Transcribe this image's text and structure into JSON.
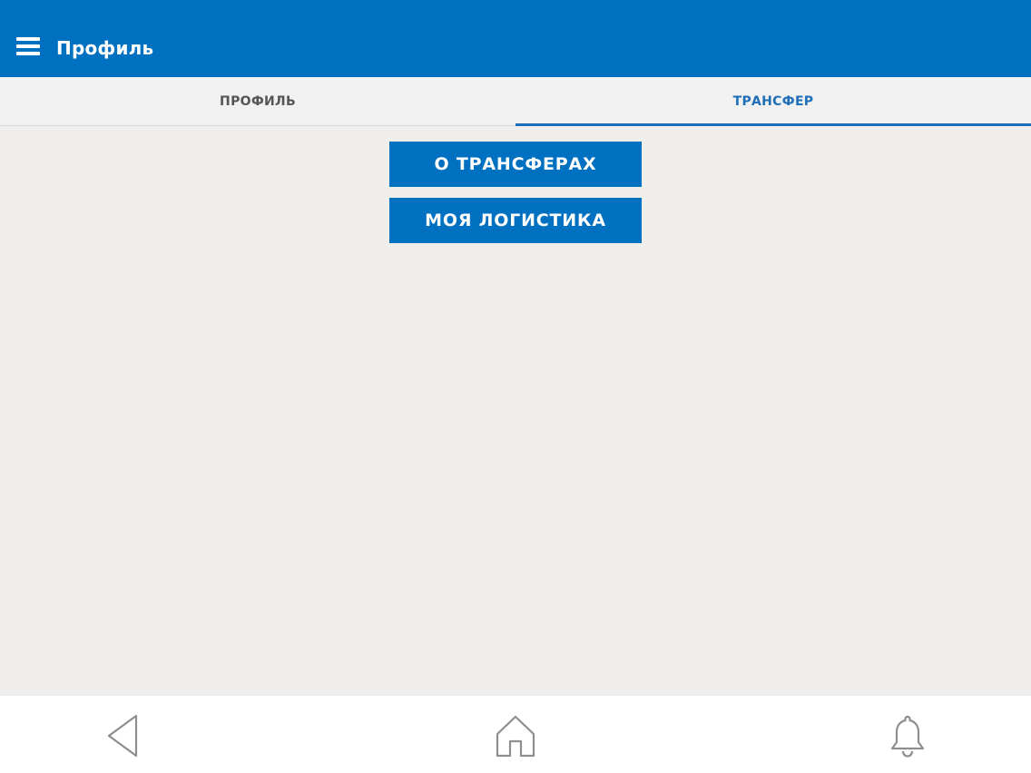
{
  "appbar": {
    "title": "Профиль",
    "background": "#0070c0",
    "menu_icon": "hamburger-menu-icon"
  },
  "tabs": [
    {
      "label": "ПРОФИЛЬ",
      "active": false
    },
    {
      "label": "ТРАНСФЕР",
      "active": true
    }
  ],
  "buttons": {
    "about_transfers": "О ТРАНСФЕРАХ",
    "my_logistics": "МОЯ ЛОГИСТИКА"
  },
  "navbar": {
    "icons": [
      "back-triangle-icon",
      "home-icon",
      "bell-icon"
    ]
  },
  "colors": {
    "accent": "#0070c0",
    "tab_active": "#1f6fb8",
    "background": "#efeeec"
  }
}
